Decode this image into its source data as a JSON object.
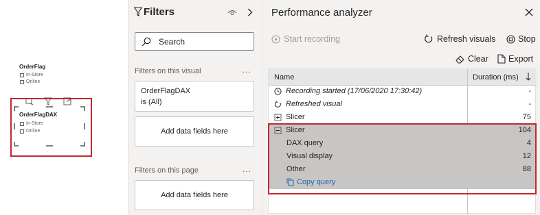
{
  "canvas": {
    "slicer1": {
      "title": "OrderFlag",
      "options": [
        "In-Store",
        "Online"
      ]
    },
    "slicer2": {
      "title": "OrderFlagDAX",
      "options": [
        "In-Store",
        "Online"
      ]
    }
  },
  "filters": {
    "title": "Filters",
    "search_placeholder": "Search",
    "visual_section": "Filters on this visual",
    "filter_card": {
      "field": "OrderFlagDAX",
      "state": "is (All)"
    },
    "add_fields_label": "Add data fields here",
    "page_section": "Filters on this page",
    "more": "..."
  },
  "perf": {
    "title": "Performance analyzer",
    "start_recording": "Start recording",
    "refresh_visuals": "Refresh visuals",
    "stop": "Stop",
    "clear": "Clear",
    "export": "Export",
    "col_name": "Name",
    "col_duration": "Duration (ms)",
    "rows": [
      {
        "name": "Recording started (17/06/2020 17:30:42)",
        "duration": "-"
      },
      {
        "name": "Refreshed visual",
        "duration": "-"
      },
      {
        "name": "Slicer",
        "duration": "75"
      },
      {
        "name": "Slicer",
        "duration": "104"
      },
      {
        "name": "DAX query",
        "duration": "4"
      },
      {
        "name": "Visual display",
        "duration": "12"
      },
      {
        "name": "Other",
        "duration": "88"
      }
    ],
    "copy_query": "Copy query"
  },
  "colors": {
    "highlight_red": "#c4272e",
    "link_blue": "#2266b5",
    "selection_gray": "#c8c6c4"
  }
}
